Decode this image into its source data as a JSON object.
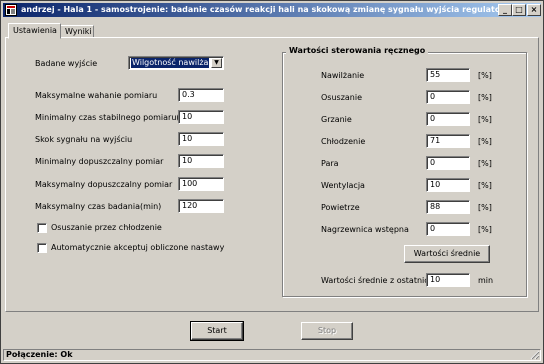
{
  "window": {
    "title": "andrzej - Hala 1 - samostrojenie: badanie czasów reakcji hali na skokową zmianę sygnału wyjścia regulatora",
    "minimize": "_",
    "maximize": "□",
    "close": "×"
  },
  "tabs": [
    {
      "label": "Ustawienia",
      "active": true
    },
    {
      "label": "Wyniki",
      "active": false
    }
  ],
  "settings": {
    "output_label": "Badane wyjście",
    "output_value": "Wilgotność nawilżanie",
    "fields": [
      {
        "label": "Maksymalne wahanie pomiaru",
        "value": "0.3"
      },
      {
        "label": "Minimalny czas stabilnego pomiaru(min)",
        "value": "10"
      },
      {
        "label": "Skok sygnału na wyjściu",
        "value": "10"
      },
      {
        "label": "Minimalny dopuszczalny pomiar",
        "value": "10"
      },
      {
        "label": "Maksymalny dopuszczalny pomiar",
        "value": "100"
      },
      {
        "label": "Maksymalny czas badania(min)",
        "value": "120"
      }
    ],
    "checkboxes": [
      {
        "label": "Osuszanie przez chłodzenie",
        "checked": false
      },
      {
        "label": "Automatycznie akceptuj obliczone nastawy",
        "checked": false
      }
    ]
  },
  "manual": {
    "title": "Wartości sterowania ręcznego",
    "unit": "[%]",
    "rows": [
      {
        "label": "Nawilżanie",
        "value": "55"
      },
      {
        "label": "Osuszanie",
        "value": "0"
      },
      {
        "label": "Grzanie",
        "value": "0"
      },
      {
        "label": "Chłodzenie",
        "value": "71"
      },
      {
        "label": "Para",
        "value": "0"
      },
      {
        "label": "Wentylacja",
        "value": "10"
      },
      {
        "label": "Powietrze",
        "value": "88"
      },
      {
        "label": "Nagrzewnica wstępna",
        "value": "0"
      }
    ],
    "avg_button": "Wartości średnie",
    "avg_label": "Wartości średnie z ostatnich",
    "avg_value": "10",
    "avg_unit": "min"
  },
  "buttons": {
    "start": "Start",
    "stop": "Stop"
  },
  "status": "Połączenie: Ok",
  "colors": {
    "titlebar_start": "#0a246a",
    "titlebar_end": "#a6caf0",
    "face": "#d4d0c8"
  }
}
